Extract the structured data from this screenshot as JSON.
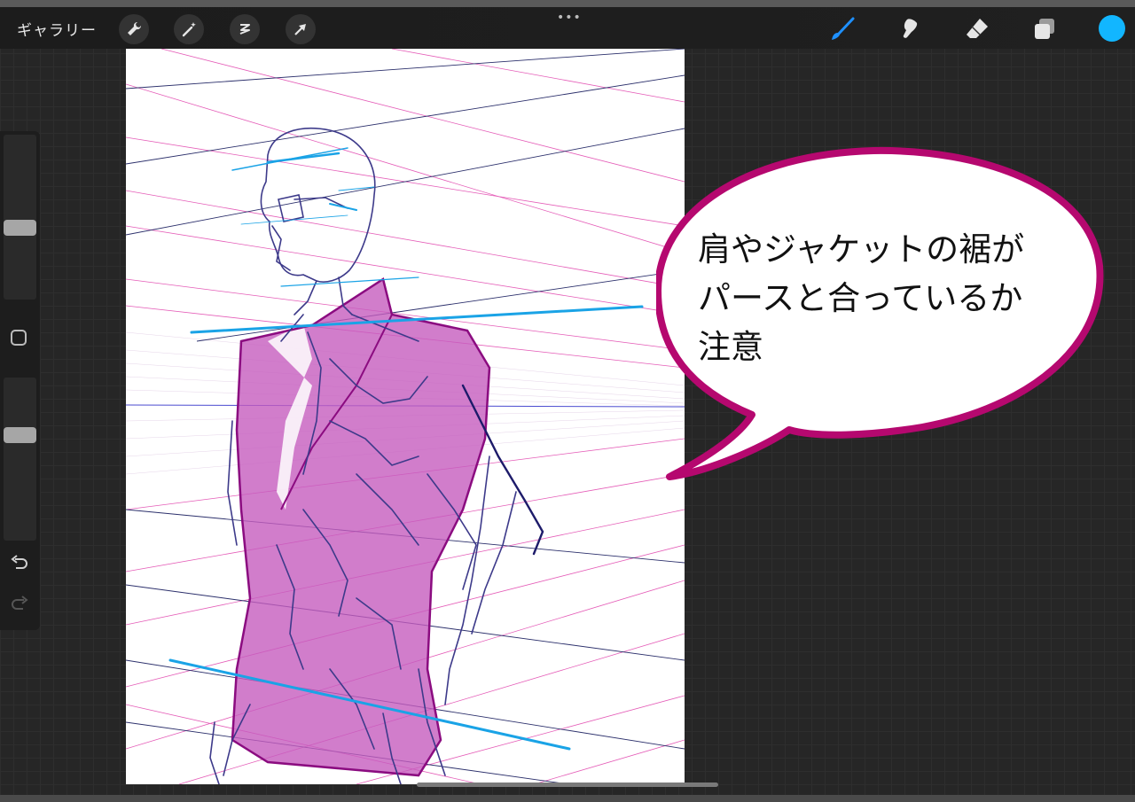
{
  "topbar": {
    "gallery_label": "ギャラリー",
    "left_tools": [
      "wrench-icon",
      "magic-wand-icon",
      "selection-icon",
      "transform-arrow-icon"
    ],
    "more_dots": "•••",
    "right_tools": [
      "brush-icon",
      "smudge-icon",
      "eraser-icon",
      "layers-icon"
    ],
    "active_tool": "brush-icon",
    "accent_color": "#1e90ff",
    "current_color": "#12b6ff"
  },
  "sidebar": {
    "brush_size_level": 0.55,
    "opacity_level": 0.35,
    "tools": [
      "modify-square-icon",
      "undo-icon",
      "redo-icon"
    ]
  },
  "canvas": {
    "annotation": {
      "text": "肩やジャケットの裾が\nパースと合っているか\n注意",
      "border_color": "#b5086f"
    },
    "colors": {
      "perspective_magenta": "#e24bb0",
      "perspective_navy": "#2b2f6b",
      "guide_blue": "#1aa3e6",
      "jacket_fill": "#c65cbe",
      "sketch_line": "#3d3a8a"
    }
  }
}
